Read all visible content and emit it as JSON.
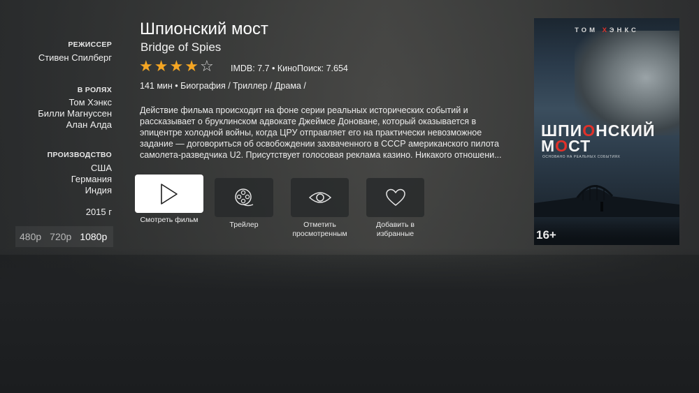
{
  "movie": {
    "title": "Шпионский мост",
    "original_title": "Bridge of Spies",
    "rating_stars": 4,
    "rating_max": 5,
    "ratings_text": "IMDB: 7.7 • КиноПоиск: 7.654",
    "info_line": "141 мин • Биография / Триллер / Драма /",
    "description": "Действие фильма происходит на фоне серии реальных исторических событий и рассказывает о бруклинском адвокате Джеймсе Доноване, который оказывается в эпицентре холодной войны, когда ЦРУ отправляет его на практически невозможное задание — договориться об освобождении захваченного в СССР американского пилота самолета-разведчика U2. Присутствует голосовая реклама казино. Никакого отношени..."
  },
  "meta": {
    "director_label": "РЕЖИССЕР",
    "director": "Стивен Спилберг",
    "cast_label": "В РОЛЯХ",
    "cast": [
      "Том Хэнкс",
      "Билли Магнуссен",
      "Алан Алда"
    ],
    "production_label": "ПРОИЗВОДСТВО",
    "countries": [
      "США",
      "Германия",
      "Индия"
    ],
    "year": "2015 г"
  },
  "quality": {
    "options": [
      "480p",
      "720p",
      "1080p"
    ],
    "selected": "1080p"
  },
  "actions": {
    "watch": "Смотреть фильм",
    "trailer": "Трейлер",
    "mark_watched_1": "Отметить",
    "mark_watched_2": "просмотренным",
    "favorite_1": "Добавить в",
    "favorite_2": "избранные"
  },
  "poster": {
    "actor_prefix": "ТОМ ",
    "actor_accent": "Х",
    "actor_middle": "",
    "actor_suffix": "ЭНКС",
    "title_line1_a": "ШПИ",
    "title_line1_b": "О",
    "title_line1_c": "НСКИЙ",
    "title_line2_a": "М",
    "title_line2_b": "О",
    "title_line2_c": "СТ",
    "tagline": "ОСНОВАНО НА РЕАЛЬНЫХ СОБЫТИЯХ",
    "age": "16+"
  },
  "colors": {
    "star": "#f5a623",
    "poster_accent": "#e0312a"
  }
}
